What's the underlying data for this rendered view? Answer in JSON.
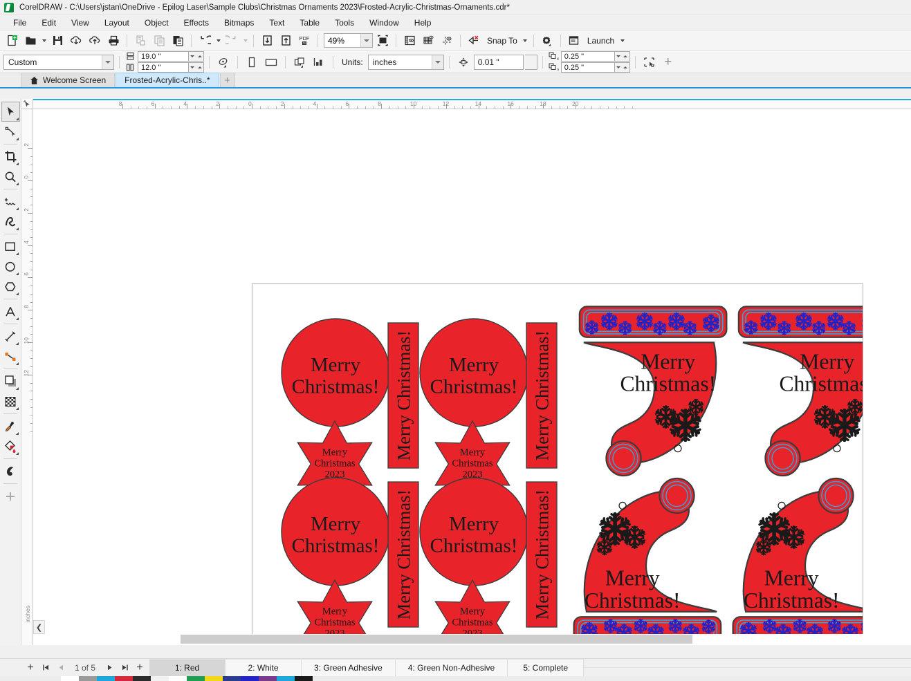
{
  "window": {
    "app_name": "CorelDRAW",
    "title": "CorelDRAW - C:\\Users\\jstan\\OneDrive - Epilog Laser\\Sample Clubs\\Christmas Ornaments 2023\\Frosted-Acrylic-Christmas-Ornaments.cdr*",
    "logo_icon": "coreldraw-balloon-icon"
  },
  "menubar": {
    "items": [
      {
        "label": "File"
      },
      {
        "label": "Edit"
      },
      {
        "label": "View"
      },
      {
        "label": "Layout"
      },
      {
        "label": "Object"
      },
      {
        "label": "Effects"
      },
      {
        "label": "Bitmaps"
      },
      {
        "label": "Text"
      },
      {
        "label": "Table"
      },
      {
        "label": "Tools"
      },
      {
        "label": "Window"
      },
      {
        "label": "Help"
      }
    ]
  },
  "toolbar": {
    "buttons": [
      {
        "name": "new-document-icon",
        "title": "New"
      },
      {
        "name": "open-document-icon",
        "title": "Open"
      },
      {
        "name": "save-icon",
        "title": "Save"
      },
      {
        "name": "import-cloud-icon",
        "title": "Import"
      },
      {
        "name": "export-cloud-icon",
        "title": "Export"
      },
      {
        "name": "print-icon",
        "title": "Print"
      },
      {
        "name": "cut-icon",
        "title": "Cut"
      },
      {
        "name": "copy-icon",
        "title": "Copy"
      },
      {
        "name": "paste-icon",
        "title": "Paste"
      },
      {
        "name": "undo-icon",
        "title": "Undo"
      },
      {
        "name": "redo-icon",
        "title": "Redo"
      },
      {
        "name": "import-arrow-icon",
        "title": "Import"
      },
      {
        "name": "export-arrow-icon",
        "title": "Export"
      },
      {
        "name": "publish-pdf-icon",
        "title": "Publish to PDF"
      }
    ],
    "zoom_level": "49%",
    "view_full_screen": "full-screen-preview-icon",
    "show_rulers": "show-rulers-icon",
    "show_grid": "show-grid-icon",
    "show_guides": "show-guides-icon",
    "snap_off": "snap-off-icon",
    "snap_to_label": "Snap To",
    "options_icon": "gear-options-icon",
    "launch_label": "Launch",
    "launch_icon": "launch-window-icon"
  },
  "propbar": {
    "page_preset": "Custom",
    "page_width": "19.0 \"",
    "page_height": "12.0 \"",
    "width_icon": "page-width-icon",
    "height_icon": "page-height-icon",
    "orientation_portrait": "portrait-icon",
    "orientation_landscape": "landscape-icon",
    "page_layout_icon": "page-layout-icon",
    "bleed_icon": "bleed-icon",
    "units_label": "Units:",
    "units_value": "inches",
    "nudge_icon": "nudge-distance-icon",
    "nudge_value": "0.01 \"",
    "duplicate_x_label": "x",
    "duplicate_x": "0.25 \"",
    "duplicate_y_label": "Y",
    "duplicate_y": "0.25 \"",
    "duplicate_icon": "duplicate-distance-icon",
    "treat_as_filled_icon": "treat-as-filled-icon",
    "add_icon": "add-toolbar-item-icon"
  },
  "doctabs": {
    "tabs": [
      {
        "label": "Welcome Screen",
        "icon": "home-icon",
        "active": false
      },
      {
        "label": "Frosted-Acrylic-Chris..*",
        "icon": "",
        "active": true
      }
    ],
    "add_tab": "+"
  },
  "toolbox": {
    "tools": [
      {
        "name": "pick-tool",
        "icon": "arrow-cursor-icon",
        "active": true,
        "flyout": true
      },
      {
        "name": "shape-tool",
        "icon": "node-edit-icon",
        "active": false,
        "flyout": true
      },
      {
        "name": "crop-tool",
        "icon": "crop-icon",
        "active": false,
        "flyout": true
      },
      {
        "name": "zoom-tool",
        "icon": "magnifier-icon",
        "active": false,
        "flyout": true
      },
      {
        "name": "freehand-tool",
        "icon": "freehand-curve-icon",
        "active": false,
        "flyout": true
      },
      {
        "name": "artistic-media-tool",
        "icon": "artistic-media-icon",
        "active": false,
        "flyout": true
      },
      {
        "name": "rectangle-tool",
        "icon": "rectangle-icon",
        "active": false,
        "flyout": true
      },
      {
        "name": "ellipse-tool",
        "icon": "ellipse-icon",
        "active": false,
        "flyout": true
      },
      {
        "name": "polygon-tool",
        "icon": "polygon-icon",
        "active": false,
        "flyout": true
      },
      {
        "name": "text-tool",
        "icon": "text-a-icon",
        "active": false,
        "flyout": true
      },
      {
        "name": "parallel-dimension-tool",
        "icon": "dimension-line-icon",
        "active": false,
        "flyout": true
      },
      {
        "name": "connector-tool",
        "icon": "straight-connector-icon",
        "active": false,
        "flyout": true
      },
      {
        "name": "drop-shadow-tool",
        "icon": "drop-shadow-icon",
        "active": false,
        "flyout": true
      },
      {
        "name": "transparency-tool",
        "icon": "transparency-checker-icon",
        "active": false,
        "flyout": true
      },
      {
        "name": "color-eyedropper-tool",
        "icon": "eyedropper-icon",
        "active": false,
        "flyout": true
      },
      {
        "name": "interactive-fill-tool",
        "icon": "paint-bucket-icon",
        "active": false,
        "flyout": true
      },
      {
        "name": "smart-fill-tool",
        "icon": "smart-fill-icon",
        "active": false,
        "flyout": false
      },
      {
        "name": "customize-toolbox",
        "icon": "plus-icon",
        "active": false,
        "flyout": false
      }
    ]
  },
  "rulers": {
    "units": "inches",
    "horizontal_labels": [
      "8",
      "6",
      "4",
      "2",
      "0",
      "2",
      "4",
      "6",
      "8",
      "10",
      "12",
      "14",
      "16",
      "18",
      "20"
    ],
    "vertical_labels": [
      "2",
      "0",
      "2",
      "4",
      "6",
      "8",
      "10",
      "12"
    ]
  },
  "statusbar": {
    "add_page_before": "+",
    "first_page_icon": "first-page-icon",
    "prev_page_icon": "prev-page-icon",
    "page_counter": "1 of 5",
    "next_page_icon": "next-page-icon",
    "last_page_icon": "last-page-icon",
    "add_page_after": "+",
    "page_tabs": [
      {
        "label": "1: Red",
        "active": true
      },
      {
        "label": "2: White",
        "active": false
      },
      {
        "label": "3: Green Adhesive",
        "active": false
      },
      {
        "label": "4: Green Non-Adhesive",
        "active": false
      },
      {
        "label": "5: Complete",
        "active": false
      }
    ]
  },
  "palette": {
    "swatches": [
      "#ffffff",
      "#9a9a9a",
      "#1aa8dd",
      "#d62839",
      "#2b2b2b",
      "#f2f2f2",
      "#ffffff",
      "#1f9e55",
      "#f5d916",
      "#2a3d8f",
      "#2323c8",
      "#7a3b8f",
      "#1aa8dd",
      "#1a1a1a"
    ]
  },
  "artwork": {
    "fill_color": "#e8242a",
    "outline_color": "#3c3c3c",
    "snowflake_dark": "#1a1a1a",
    "snowflake_blue": "#2323c8",
    "cuff_line_color": "#29a8e0",
    "items": [
      {
        "type": "circle-ornament",
        "text_line1": "Merry",
        "text_line2": "Christmas!"
      },
      {
        "type": "star-ornament",
        "text_line1": "Merry",
        "text_line2": "Christmas",
        "text_line3": "2023"
      },
      {
        "type": "banner-ornament",
        "text": "Merry Christmas!"
      },
      {
        "type": "santa-hat-ornament",
        "text_line1": "Merry",
        "text_line2": "Christmas!"
      }
    ],
    "circle_text": {
      "line1": "Merry",
      "line2": "Christmas!"
    },
    "star_text": {
      "line1": "Merry",
      "line2": "Christmas",
      "line3": "2023"
    },
    "banner_text": "Merry Christmas!",
    "hat_text": {
      "line1": "Merry",
      "line2": "Christmas!"
    }
  }
}
